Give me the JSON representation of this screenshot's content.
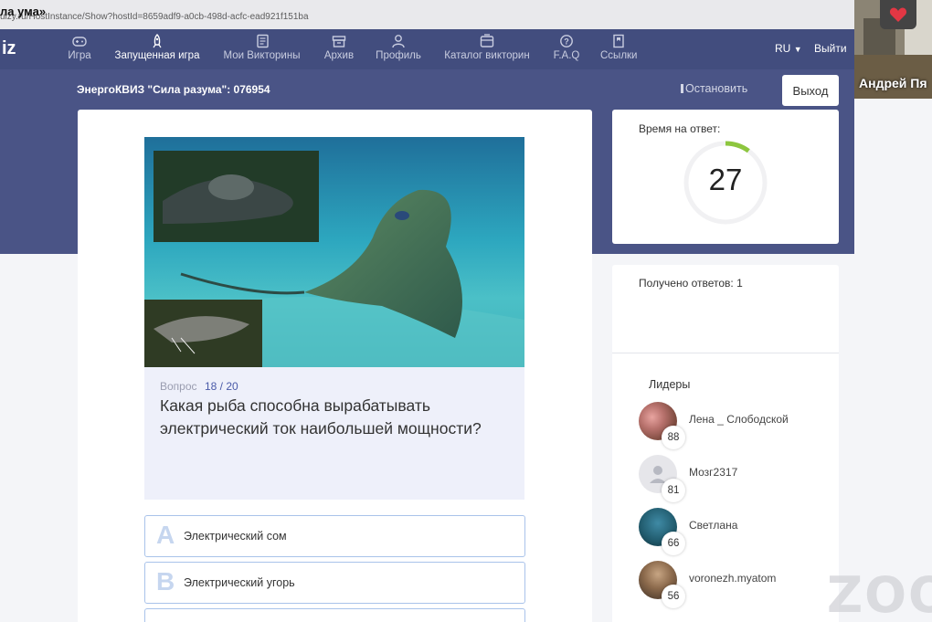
{
  "window": {
    "title": "ла ума»",
    "url": "uizy.ru/HostInstance/Show?hostId=8659adf9-a0cb-498d-acfc-ead921f151ba"
  },
  "nav": {
    "logo": "iz",
    "items": [
      {
        "label": "Игра",
        "icon": "gamepad-icon"
      },
      {
        "label": "Запущенная игра",
        "icon": "rocket-icon",
        "active": true
      },
      {
        "label": "Мои Викторины",
        "icon": "document-icon"
      },
      {
        "label": "Архив",
        "icon": "archive-icon"
      },
      {
        "label": "Профиль",
        "icon": "user-icon"
      },
      {
        "label": "Каталог викторин",
        "icon": "catalog-icon"
      },
      {
        "label": "F.A.Q",
        "icon": "help-icon"
      },
      {
        "label": "Ссылки",
        "icon": "bookmark-icon"
      }
    ],
    "lang": "RU",
    "exit": "Выйти"
  },
  "session": {
    "title": "ЭнергоКВИЗ \"Сила разума\": 076954",
    "stop_label": "Остановить",
    "exit_label": "Выход"
  },
  "question": {
    "counter_label": "Вопрос",
    "counter": "18 / 20",
    "text": "Какая рыба способна вырабатывать электрический ток наибольшей мощности?",
    "answers": [
      {
        "letter": "A",
        "text": "Электрический сом"
      },
      {
        "letter": "B",
        "text": "Электрический угорь"
      }
    ]
  },
  "timer": {
    "label": "Время на ответ:",
    "value": "27",
    "fraction_remaining": 0.9
  },
  "stats": {
    "received": "Получено ответов: 1",
    "leaders_title": "Лидеры",
    "leaders": [
      {
        "name": "Лена _ Слободской",
        "score": "88"
      },
      {
        "name": "Мозг2317",
        "score": "81"
      },
      {
        "name": "Светлана",
        "score": "66"
      },
      {
        "name": "voronezh.myatom",
        "score": "56"
      }
    ]
  },
  "video": {
    "participant": "Андрей Пя"
  },
  "watermark": "ZOO",
  "colors": {
    "nav_bg": "#424d7e",
    "banner_bg": "#4a5486",
    "accent": "#4a5aa8",
    "timer_arc": "#8dc63f",
    "answer_border": "#a9c3ea"
  }
}
